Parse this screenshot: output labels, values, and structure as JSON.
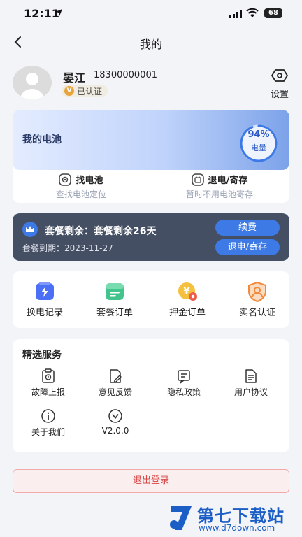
{
  "status_bar": {
    "time": "12:11",
    "battery": "68"
  },
  "nav": {
    "title": "我的"
  },
  "user": {
    "name": "晏江",
    "phone": "18300000001",
    "verified": "已认证",
    "verified_icon": "V"
  },
  "settings": {
    "label": "设置"
  },
  "battery": {
    "title": "我的电池",
    "percent_text": "94%",
    "percent": 94,
    "gauge_label": "电量",
    "find": {
      "label": "找电池",
      "sub": "查找电池定位"
    },
    "return": {
      "label": "退电/寄存",
      "sub": "暂时不用电池寄存"
    }
  },
  "plan": {
    "title": "套餐剩余：套餐剩余26天",
    "expiry": "套餐到期：2023-11-27",
    "renew_label": "续费",
    "return_label": "退电/寄存"
  },
  "quick": [
    {
      "label": "换电记录",
      "icon": "battery-swap-icon"
    },
    {
      "label": "套餐订单",
      "icon": "package-order-icon"
    },
    {
      "label": "押金订单",
      "icon": "deposit-order-icon"
    },
    {
      "label": "实名认证",
      "icon": "id-verify-icon"
    }
  ],
  "services": {
    "title": "精选服务",
    "items": [
      {
        "label": "故障上报",
        "icon": "fault-report-icon"
      },
      {
        "label": "意见反馈",
        "icon": "feedback-icon"
      },
      {
        "label": "隐私政策",
        "icon": "privacy-icon"
      },
      {
        "label": "用户协议",
        "icon": "agreement-icon"
      },
      {
        "label": "关于我们",
        "icon": "info-icon"
      },
      {
        "label": "V2.0.0",
        "icon": "version-icon"
      }
    ]
  },
  "logout_label": "退出登录",
  "watermark": {
    "title": "第七下载站",
    "url": "www.d7down.com"
  },
  "colors": {
    "accent": "#3d7ae5",
    "plan_bg": "#454f63",
    "logout": "#d84a4a"
  }
}
